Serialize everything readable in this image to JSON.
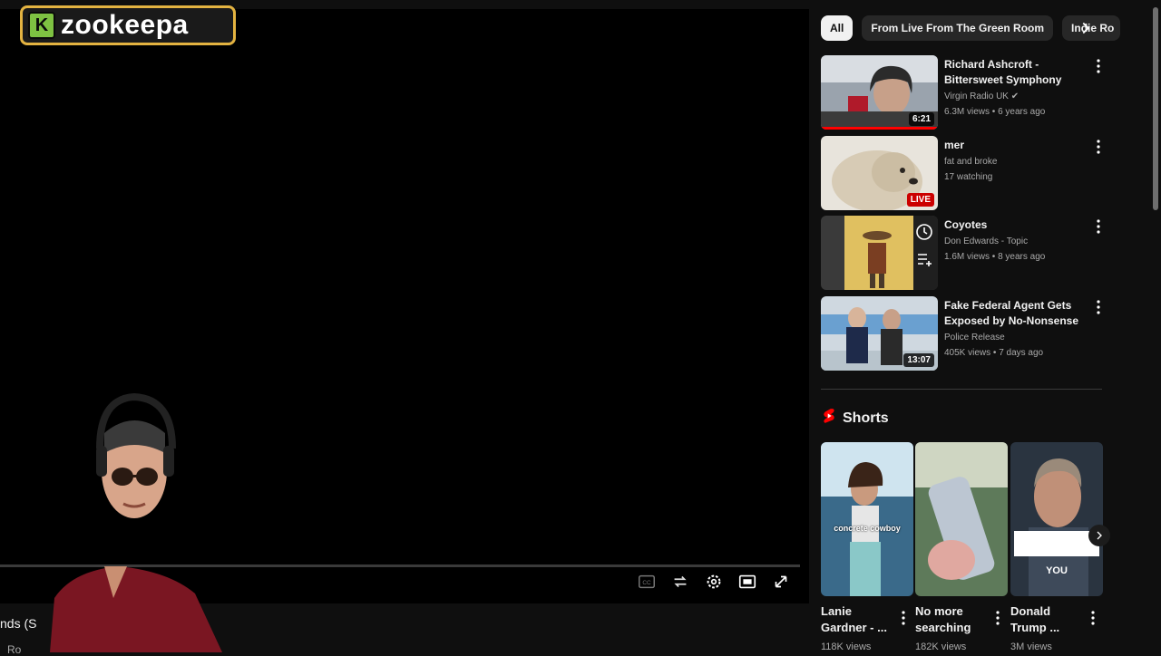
{
  "overlay": {
    "logo_letter": "K",
    "logo_text": "zookeepa"
  },
  "player": {
    "under_title": "nds (S",
    "under_small": "Ro",
    "controls": [
      "subtitles-icon",
      "loop-icon",
      "settings-icon",
      "miniplayer-icon",
      "fullscreen-icon"
    ]
  },
  "chips": [
    "All",
    "From Live From The Green Room",
    "Indie Ro"
  ],
  "recommendations": [
    {
      "title": "Richard Ashcroft - Bittersweet Symphony (Live on The Chris ...",
      "channel": "Virgin Radio UK",
      "verified": true,
      "meta": "6.3M views • 6 years ago",
      "badge": "6:21",
      "progress": 1.0
    },
    {
      "title": "mer",
      "channel": "fat and broke",
      "meta": "17 watching",
      "badge": "LIVE",
      "live": true
    },
    {
      "title": "Coyotes",
      "channel": "Don Edwards - Topic",
      "meta": "1.6M views • 8 years ago",
      "badge": ""
    },
    {
      "title": "Fake Federal Agent Gets Exposed by No-Nonsense Cop...",
      "channel": "Police Release",
      "meta": "405K views • 7 days ago",
      "badge": "13:07"
    }
  ],
  "shorts": {
    "heading": "Shorts",
    "items": [
      {
        "title": "Lanie Gardner - ...",
        "views": "118K views",
        "overlay": "concrete cowboy"
      },
      {
        "title": "No more searching f...",
        "views": "182K views",
        "overlay": ""
      },
      {
        "title": "Donald Trump ...",
        "views": "3M views",
        "overlay": "YOU"
      }
    ]
  },
  "colors": {
    "accent": "#ff0000",
    "logo_border": "#e3b341",
    "logo_k": "#7ec242",
    "live": "#cc0000"
  }
}
